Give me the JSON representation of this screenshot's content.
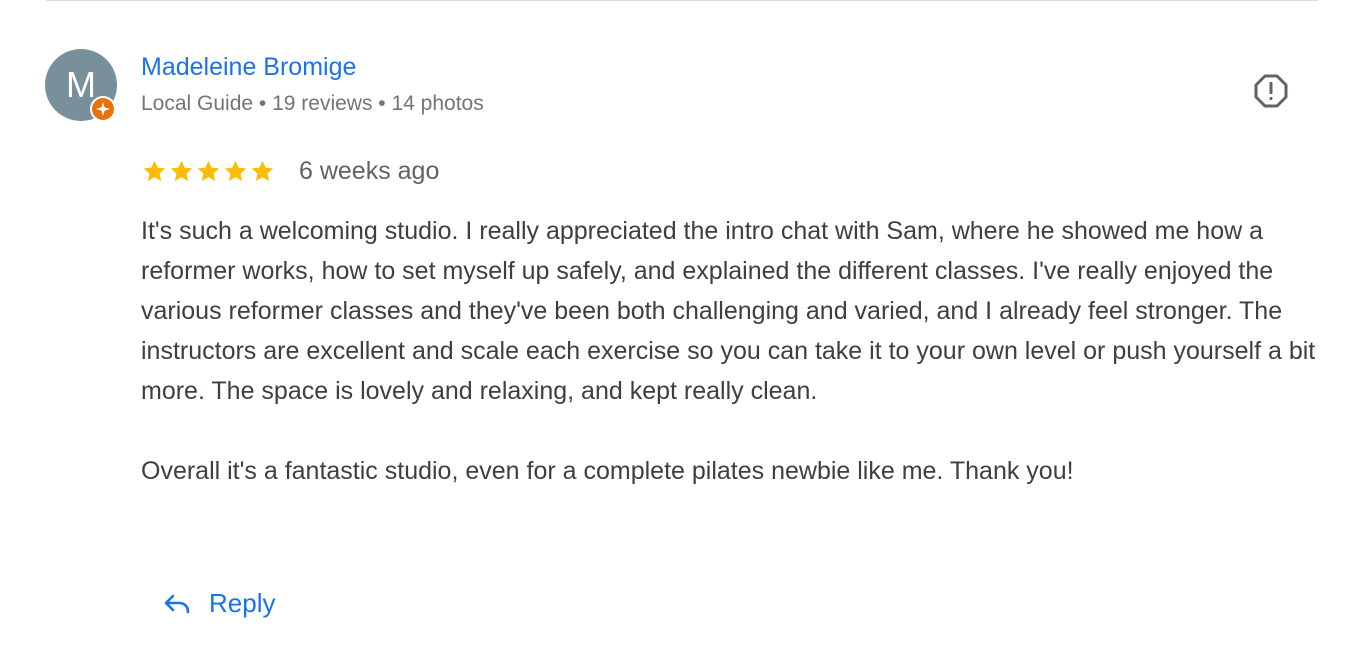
{
  "reviewer": {
    "initial": "M",
    "name": "Madeleine Bromige",
    "meta": "Local Guide • 19 reviews • 14 photos",
    "avatar_color": "#78909c",
    "badge_color": "#e8710a"
  },
  "review": {
    "rating": 5,
    "rating_max": 5,
    "date": "6 weeks ago",
    "paragraphs": [
      "It's such a welcoming studio. I really appreciated the intro chat with Sam, where he showed me how a reformer works, how to set myself up safely, and explained the different classes. I've really enjoyed the various reformer classes and they've been both challenging and varied, and I already feel stronger. The instructors are excellent and scale each exercise so you can take it to your own level or push yourself a bit more. The space is lovely and relaxing, and kept really clean.",
      "Overall it's a fantastic studio, even for a complete pilates newbie like me. Thank you!"
    ]
  },
  "actions": {
    "reply_label": "Reply",
    "reply_icon": "reply-arrow-icon",
    "flag_icon": "report-flag-icon"
  },
  "colors": {
    "link": "#1a73e8",
    "star": "#fbbc04",
    "text": "#3c4043",
    "muted": "#70757a",
    "icon": "#5f6368"
  }
}
